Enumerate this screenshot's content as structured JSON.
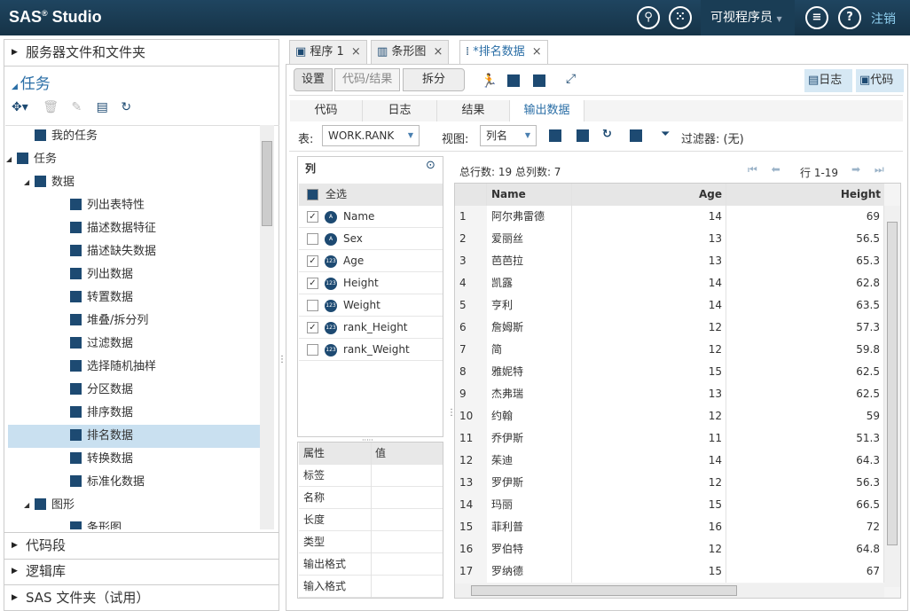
{
  "header": {
    "app": "SAS",
    "app_sup": "®",
    "app_suffix": " Studio",
    "role": "可视程序员",
    "logout": "注销"
  },
  "left": {
    "sections": [
      "服务器文件和文件夹",
      "任务",
      "代码段",
      "逻辑库",
      "SAS 文件夹（试用）"
    ],
    "tree": [
      {
        "label": "我的任务",
        "indent": 1
      },
      {
        "label": "任务",
        "indent": 0,
        "toggle": "◢"
      },
      {
        "label": "数据",
        "indent": 1,
        "toggle": "◢"
      },
      {
        "label": "列出表特性",
        "indent": 3
      },
      {
        "label": "描述数据特征",
        "indent": 3
      },
      {
        "label": "描述缺失数据",
        "indent": 3
      },
      {
        "label": "列出数据",
        "indent": 3
      },
      {
        "label": "转置数据",
        "indent": 3
      },
      {
        "label": "堆叠/拆分列",
        "indent": 3
      },
      {
        "label": "过滤数据",
        "indent": 3
      },
      {
        "label": "选择随机抽样",
        "indent": 3
      },
      {
        "label": "分区数据",
        "indent": 3
      },
      {
        "label": "排序数据",
        "indent": 3
      },
      {
        "label": "排名数据",
        "indent": 3,
        "selected": true
      },
      {
        "label": "转换数据",
        "indent": 3
      },
      {
        "label": "标准化数据",
        "indent": 3
      },
      {
        "label": "图形",
        "indent": 1,
        "toggle": "◢"
      },
      {
        "label": "条形图",
        "indent": 3
      }
    ]
  },
  "tabs": [
    {
      "label": "程序 1"
    },
    {
      "label": "条形图"
    },
    {
      "label": "*排名数据",
      "active": true
    }
  ],
  "toolbar": {
    "segments": [
      "设置",
      "代码/结果",
      "拆分"
    ],
    "log": "日志",
    "code": "代码"
  },
  "subtabs": [
    "代码",
    "日志",
    "结果",
    "输出数据"
  ],
  "tablebar": {
    "table_label": "表:",
    "table": "WORK.RANK",
    "view_label": "视图:",
    "view": "列名",
    "filter": "过滤器: (无)"
  },
  "columns": {
    "title": "列",
    "select_all": "全选",
    "items": [
      {
        "name": "Name",
        "type": "A",
        "checked": true
      },
      {
        "name": "Sex",
        "type": "A",
        "checked": false
      },
      {
        "name": "Age",
        "type": "123",
        "checked": true
      },
      {
        "name": "Height",
        "type": "123",
        "checked": true
      },
      {
        "name": "Weight",
        "type": "123",
        "checked": false
      },
      {
        "name": "rank_Height",
        "type": "123",
        "checked": true
      },
      {
        "name": "rank_Weight",
        "type": "123",
        "checked": false
      }
    ]
  },
  "properties": {
    "headers": [
      "属性",
      "值"
    ],
    "rows": [
      "标签",
      "名称",
      "长度",
      "类型",
      "输出格式",
      "输入格式"
    ]
  },
  "grid": {
    "summary": "总行数: 19   总列数: 7",
    "range": "行 1-19",
    "headers": [
      "Name",
      "Age",
      "Height"
    ],
    "rows": [
      [
        "1",
        "阿尔弗雷德",
        "14",
        "69"
      ],
      [
        "2",
        "爱丽丝",
        "13",
        "56.5"
      ],
      [
        "3",
        "芭芭拉",
        "13",
        "65.3"
      ],
      [
        "4",
        "凯露",
        "14",
        "62.8"
      ],
      [
        "5",
        "亨利",
        "14",
        "63.5"
      ],
      [
        "6",
        "詹姆斯",
        "12",
        "57.3"
      ],
      [
        "7",
        "简",
        "12",
        "59.8"
      ],
      [
        "8",
        "雅妮特",
        "15",
        "62.5"
      ],
      [
        "9",
        "杰弗瑞",
        "13",
        "62.5"
      ],
      [
        "10",
        "约翰",
        "12",
        "59"
      ],
      [
        "11",
        "乔伊斯",
        "11",
        "51.3"
      ],
      [
        "12",
        "茱迪",
        "14",
        "64.3"
      ],
      [
        "13",
        "罗伊斯",
        "12",
        "56.3"
      ],
      [
        "14",
        "玛丽",
        "15",
        "66.5"
      ],
      [
        "15",
        "菲利普",
        "16",
        "72"
      ],
      [
        "16",
        "罗伯特",
        "12",
        "64.8"
      ],
      [
        "17",
        "罗纳德",
        "15",
        "67"
      ]
    ]
  }
}
